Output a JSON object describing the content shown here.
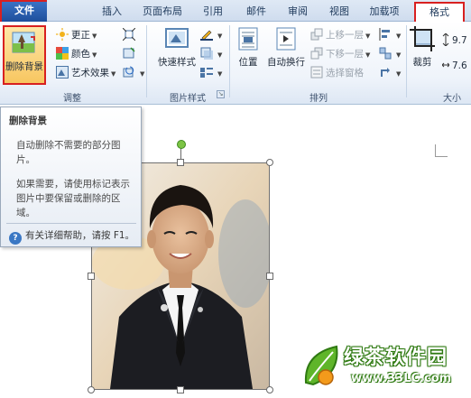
{
  "tabs": {
    "file": "文件",
    "insert": "插入",
    "page_layout": "页面布局",
    "references": "引用",
    "mailings": "邮件",
    "review": "审阅",
    "view": "视图",
    "addins": "加载项",
    "format": "格式"
  },
  "ribbon": {
    "adjust": {
      "remove_background": "删除背景",
      "corrections": "更正",
      "color": "颜色",
      "artistic_effects": "艺术效果",
      "label": "调整"
    },
    "picture_styles": {
      "quick_styles": "快速样式",
      "label": "图片样式"
    },
    "arrange": {
      "position": "位置",
      "wrap_text": "自动换行",
      "bring_forward": "上移一层",
      "send_backward": "下移一层",
      "selection_pane": "选择窗格",
      "label": "排列"
    },
    "size": {
      "crop": "裁剪",
      "height": "9.7",
      "width": "7.6",
      "label": "大小"
    }
  },
  "tooltip": {
    "title": "删除背景",
    "line1": "自动删除不需要的部分图",
    "line2": "片。",
    "line3": "如果需要，请使用标记表示",
    "line4": "图片中要保留或删除的区",
    "line5": "域。",
    "help": "有关详细帮助，请按 F1。"
  },
  "watermark": {
    "brand": "绿茶软件园",
    "url": "www.33LC.com"
  },
  "colors": {
    "highlight_border": "#d82020",
    "file_tab": "#2a5fae",
    "ribbon_bg": "#eef3fa"
  }
}
